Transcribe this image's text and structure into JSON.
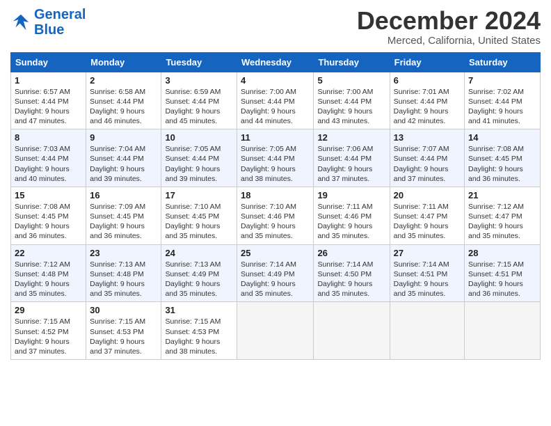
{
  "header": {
    "logo_line1": "General",
    "logo_line2": "Blue",
    "month": "December 2024",
    "location": "Merced, California, United States"
  },
  "weekdays": [
    "Sunday",
    "Monday",
    "Tuesday",
    "Wednesday",
    "Thursday",
    "Friday",
    "Saturday"
  ],
  "weeks": [
    [
      {
        "day": "1",
        "info": "Sunrise: 6:57 AM\nSunset: 4:44 PM\nDaylight: 9 hours\nand 47 minutes."
      },
      {
        "day": "2",
        "info": "Sunrise: 6:58 AM\nSunset: 4:44 PM\nDaylight: 9 hours\nand 46 minutes."
      },
      {
        "day": "3",
        "info": "Sunrise: 6:59 AM\nSunset: 4:44 PM\nDaylight: 9 hours\nand 45 minutes."
      },
      {
        "day": "4",
        "info": "Sunrise: 7:00 AM\nSunset: 4:44 PM\nDaylight: 9 hours\nand 44 minutes."
      },
      {
        "day": "5",
        "info": "Sunrise: 7:00 AM\nSunset: 4:44 PM\nDaylight: 9 hours\nand 43 minutes."
      },
      {
        "day": "6",
        "info": "Sunrise: 7:01 AM\nSunset: 4:44 PM\nDaylight: 9 hours\nand 42 minutes."
      },
      {
        "day": "7",
        "info": "Sunrise: 7:02 AM\nSunset: 4:44 PM\nDaylight: 9 hours\nand 41 minutes."
      }
    ],
    [
      {
        "day": "8",
        "info": "Sunrise: 7:03 AM\nSunset: 4:44 PM\nDaylight: 9 hours\nand 40 minutes."
      },
      {
        "day": "9",
        "info": "Sunrise: 7:04 AM\nSunset: 4:44 PM\nDaylight: 9 hours\nand 39 minutes."
      },
      {
        "day": "10",
        "info": "Sunrise: 7:05 AM\nSunset: 4:44 PM\nDaylight: 9 hours\nand 39 minutes."
      },
      {
        "day": "11",
        "info": "Sunrise: 7:05 AM\nSunset: 4:44 PM\nDaylight: 9 hours\nand 38 minutes."
      },
      {
        "day": "12",
        "info": "Sunrise: 7:06 AM\nSunset: 4:44 PM\nDaylight: 9 hours\nand 37 minutes."
      },
      {
        "day": "13",
        "info": "Sunrise: 7:07 AM\nSunset: 4:44 PM\nDaylight: 9 hours\nand 37 minutes."
      },
      {
        "day": "14",
        "info": "Sunrise: 7:08 AM\nSunset: 4:45 PM\nDaylight: 9 hours\nand 36 minutes."
      }
    ],
    [
      {
        "day": "15",
        "info": "Sunrise: 7:08 AM\nSunset: 4:45 PM\nDaylight: 9 hours\nand 36 minutes."
      },
      {
        "day": "16",
        "info": "Sunrise: 7:09 AM\nSunset: 4:45 PM\nDaylight: 9 hours\nand 36 minutes."
      },
      {
        "day": "17",
        "info": "Sunrise: 7:10 AM\nSunset: 4:45 PM\nDaylight: 9 hours\nand 35 minutes."
      },
      {
        "day": "18",
        "info": "Sunrise: 7:10 AM\nSunset: 4:46 PM\nDaylight: 9 hours\nand 35 minutes."
      },
      {
        "day": "19",
        "info": "Sunrise: 7:11 AM\nSunset: 4:46 PM\nDaylight: 9 hours\nand 35 minutes."
      },
      {
        "day": "20",
        "info": "Sunrise: 7:11 AM\nSunset: 4:47 PM\nDaylight: 9 hours\nand 35 minutes."
      },
      {
        "day": "21",
        "info": "Sunrise: 7:12 AM\nSunset: 4:47 PM\nDaylight: 9 hours\nand 35 minutes."
      }
    ],
    [
      {
        "day": "22",
        "info": "Sunrise: 7:12 AM\nSunset: 4:48 PM\nDaylight: 9 hours\nand 35 minutes."
      },
      {
        "day": "23",
        "info": "Sunrise: 7:13 AM\nSunset: 4:48 PM\nDaylight: 9 hours\nand 35 minutes."
      },
      {
        "day": "24",
        "info": "Sunrise: 7:13 AM\nSunset: 4:49 PM\nDaylight: 9 hours\nand 35 minutes."
      },
      {
        "day": "25",
        "info": "Sunrise: 7:14 AM\nSunset: 4:49 PM\nDaylight: 9 hours\nand 35 minutes."
      },
      {
        "day": "26",
        "info": "Sunrise: 7:14 AM\nSunset: 4:50 PM\nDaylight: 9 hours\nand 35 minutes."
      },
      {
        "day": "27",
        "info": "Sunrise: 7:14 AM\nSunset: 4:51 PM\nDaylight: 9 hours\nand 35 minutes."
      },
      {
        "day": "28",
        "info": "Sunrise: 7:15 AM\nSunset: 4:51 PM\nDaylight: 9 hours\nand 36 minutes."
      }
    ],
    [
      {
        "day": "29",
        "info": "Sunrise: 7:15 AM\nSunset: 4:52 PM\nDaylight: 9 hours\nand 37 minutes."
      },
      {
        "day": "30",
        "info": "Sunrise: 7:15 AM\nSunset: 4:53 PM\nDaylight: 9 hours\nand 37 minutes."
      },
      {
        "day": "31",
        "info": "Sunrise: 7:15 AM\nSunset: 4:53 PM\nDaylight: 9 hours\nand 38 minutes."
      },
      null,
      null,
      null,
      null
    ]
  ]
}
